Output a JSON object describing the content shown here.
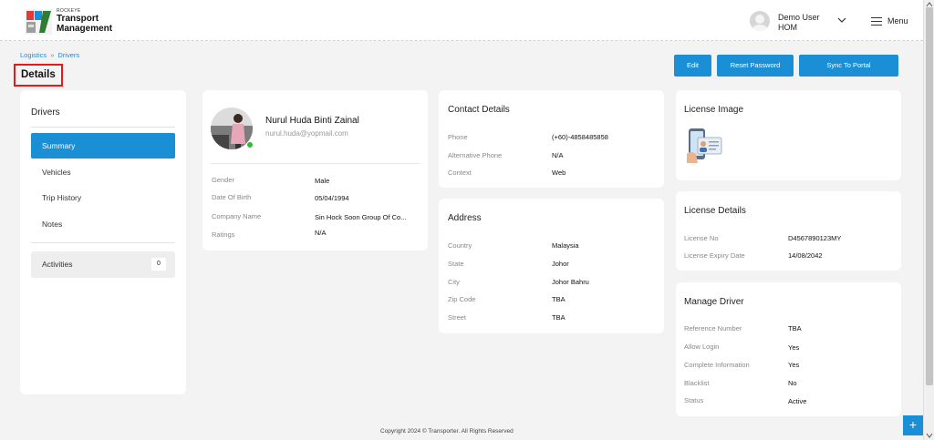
{
  "header": {
    "brand_small": "ROCKEYE",
    "brand_line1": "Transport",
    "brand_line2": "Management",
    "user_name": "Demo User",
    "user_role": "HOM",
    "menu_label": "Menu",
    "icons": [
      "logo-mark",
      "user-avatar",
      "chevron-down-icon",
      "hamburger-menu-icon"
    ]
  },
  "breadcrumb": {
    "root": "Logistics",
    "separator": "»",
    "current": "Drivers"
  },
  "page_title": "Details",
  "actions": {
    "edit": "Edit",
    "reset_password": "Reset Password",
    "sync_to_portal": "Sync To Portal"
  },
  "sidebar": {
    "heading": "Drivers",
    "items": [
      {
        "label": "Summary",
        "active": true
      },
      {
        "label": "Vehicles",
        "active": false
      },
      {
        "label": "Trip History",
        "active": false
      },
      {
        "label": "Notes",
        "active": false
      }
    ],
    "activities": {
      "label": "Activities",
      "count": "0"
    }
  },
  "profile": {
    "name": "Nurul Huda Binti Zainal",
    "email": "nurul.huda@yopmail.com",
    "fields": [
      {
        "label": "Gender",
        "value": "Male"
      },
      {
        "label": "Date Of Birth",
        "value": "05/04/1994"
      },
      {
        "label": "Company Name",
        "value": "Sin Hock Soon Group Of Co..."
      },
      {
        "label": "Ratings",
        "value": "N/A"
      }
    ]
  },
  "contact": {
    "title": "Contact Details",
    "fields": [
      {
        "label": "Phone",
        "value": "(+60)-4858485858"
      },
      {
        "label": "Alternative Phone",
        "value": "N/A"
      },
      {
        "label": "Context",
        "value": "Web"
      }
    ]
  },
  "address": {
    "title": "Address",
    "fields": [
      {
        "label": "Country",
        "value": "Malaysia"
      },
      {
        "label": "State",
        "value": "Johor"
      },
      {
        "label": "City",
        "value": "Johor Bahru"
      },
      {
        "label": "Zip Code",
        "value": "TBA"
      },
      {
        "label": "Street",
        "value": "TBA"
      }
    ]
  },
  "license_image": {
    "title": "License Image"
  },
  "license_details": {
    "title": "License Details",
    "fields": [
      {
        "label": "License No",
        "value": "D4567890123MY"
      },
      {
        "label": "License Expiry Date",
        "value": "14/08/2042"
      }
    ]
  },
  "manage_driver": {
    "title": "Manage Driver",
    "fields": [
      {
        "label": "Reference Number",
        "value": "TBA"
      },
      {
        "label": "Allow Login",
        "value": "Yes"
      },
      {
        "label": "Complete Information",
        "value": "Yes"
      },
      {
        "label": "Blacklist",
        "value": "No"
      },
      {
        "label": "Status",
        "value": "Active"
      }
    ]
  },
  "footer": {
    "copyright": "Copyright 2024 © Transporter. All Rights Reserved",
    "fab_symbol": "+"
  },
  "colors": {
    "accent": "#1a8fd6",
    "highlight_border": "#e01b1b",
    "online": "#2ebd2e"
  }
}
